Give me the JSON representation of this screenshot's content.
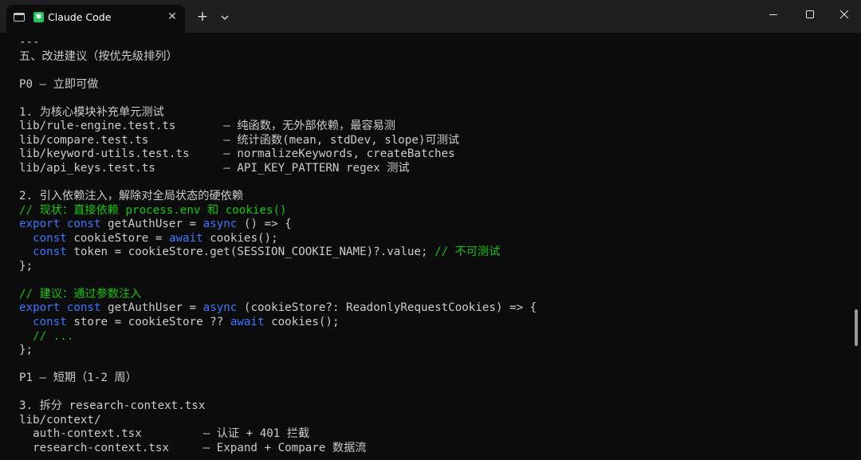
{
  "titlebar": {
    "tab_icon": "terminal-icon",
    "app_icon_glyph": "✱",
    "app_icon_color": "#21c25e",
    "tab_title": "Claude Code",
    "close_glyph": "✕",
    "new_tab_glyph": "+",
    "dropdown_icon": "chevron-down-icon"
  },
  "window_controls": {
    "minimize_icon": "minimize-icon",
    "maximize_icon": "maximize-icon",
    "close_icon": "close-icon"
  },
  "colors": {
    "background": "#0c0c0c",
    "titlebar": "#1f1f1f",
    "text": "#cccccc",
    "keyword": "#3b78ff",
    "comment": "#16c60c"
  },
  "terminal": {
    "lines": [
      {
        "segments": [
          {
            "t": "---",
            "c": "w"
          }
        ]
      },
      {
        "segments": [
          {
            "t": "五、改进建议（按优先级排列）",
            "c": "w"
          }
        ]
      },
      {
        "segments": []
      },
      {
        "segments": [
          {
            "t": "P0 – 立即可做",
            "c": "w"
          }
        ]
      },
      {
        "segments": []
      },
      {
        "segments": [
          {
            "t": "1. 为核心模块补充单元测试",
            "c": "w"
          }
        ]
      },
      {
        "segments": [
          {
            "t": "lib/rule-engine.test.ts       – 纯函数，无外部依赖，最容易测",
            "c": "w"
          }
        ]
      },
      {
        "segments": [
          {
            "t": "lib/compare.test.ts           – 统计函数(mean, stdDev, slope)可测试",
            "c": "w"
          }
        ]
      },
      {
        "segments": [
          {
            "t": "lib/keyword-utils.test.ts     – normalizeKeywords, createBatches",
            "c": "w"
          }
        ]
      },
      {
        "segments": [
          {
            "t": "lib/api_keys.test.ts          – API_KEY_PATTERN regex 测试",
            "c": "w"
          }
        ]
      },
      {
        "segments": []
      },
      {
        "segments": [
          {
            "t": "2. 引入依赖注入，解除对全局状态的硬依赖",
            "c": "w"
          }
        ]
      },
      {
        "segments": [
          {
            "t": "// 现状：直接依赖 process.env 和 cookies()",
            "c": "cm"
          }
        ]
      },
      {
        "segments": [
          {
            "t": "export",
            "c": "kw"
          },
          {
            "t": " ",
            "c": "w"
          },
          {
            "t": "const",
            "c": "kw"
          },
          {
            "t": " getAuthUser = ",
            "c": "w"
          },
          {
            "t": "async",
            "c": "kw"
          },
          {
            "t": " () => {",
            "c": "w"
          }
        ]
      },
      {
        "segments": [
          {
            "t": "  ",
            "c": "w"
          },
          {
            "t": "const",
            "c": "kw"
          },
          {
            "t": " cookieStore = ",
            "c": "w"
          },
          {
            "t": "await",
            "c": "kw"
          },
          {
            "t": " cookies();",
            "c": "w"
          }
        ]
      },
      {
        "segments": [
          {
            "t": "  ",
            "c": "w"
          },
          {
            "t": "const",
            "c": "kw"
          },
          {
            "t": " token = cookieStore.get(SESSION_COOKIE_NAME)?.value; ",
            "c": "w"
          },
          {
            "t": "// 不可测试",
            "c": "cm"
          }
        ]
      },
      {
        "segments": [
          {
            "t": "};",
            "c": "w"
          }
        ]
      },
      {
        "segments": []
      },
      {
        "segments": [
          {
            "t": "// 建议：通过参数注入",
            "c": "cm"
          }
        ]
      },
      {
        "segments": [
          {
            "t": "export",
            "c": "kw"
          },
          {
            "t": " ",
            "c": "w"
          },
          {
            "t": "const",
            "c": "kw"
          },
          {
            "t": " getAuthUser = ",
            "c": "w"
          },
          {
            "t": "async",
            "c": "kw"
          },
          {
            "t": " (cookieStore?: ReadonlyRequestCookies) => {",
            "c": "w"
          }
        ]
      },
      {
        "segments": [
          {
            "t": "  ",
            "c": "w"
          },
          {
            "t": "const",
            "c": "kw"
          },
          {
            "t": " store = cookieStore ?? ",
            "c": "w"
          },
          {
            "t": "await",
            "c": "kw"
          },
          {
            "t": " cookies();",
            "c": "w"
          }
        ]
      },
      {
        "segments": [
          {
            "t": "  ",
            "c": "w"
          },
          {
            "t": "// ...",
            "c": "cm"
          }
        ]
      },
      {
        "segments": [
          {
            "t": "};",
            "c": "w"
          }
        ]
      },
      {
        "segments": []
      },
      {
        "segments": [
          {
            "t": "P1 – 短期（1-2 周）",
            "c": "w"
          }
        ]
      },
      {
        "segments": []
      },
      {
        "segments": [
          {
            "t": "3. 拆分 research-context.tsx",
            "c": "w"
          }
        ]
      },
      {
        "segments": [
          {
            "t": "lib/context/",
            "c": "w"
          }
        ]
      },
      {
        "segments": [
          {
            "t": "  auth-context.tsx         – 认证 + 401 拦截",
            "c": "w"
          }
        ]
      },
      {
        "segments": [
          {
            "t": "  research-context.tsx     – Expand + Compare 数据流",
            "c": "w"
          }
        ]
      }
    ]
  }
}
